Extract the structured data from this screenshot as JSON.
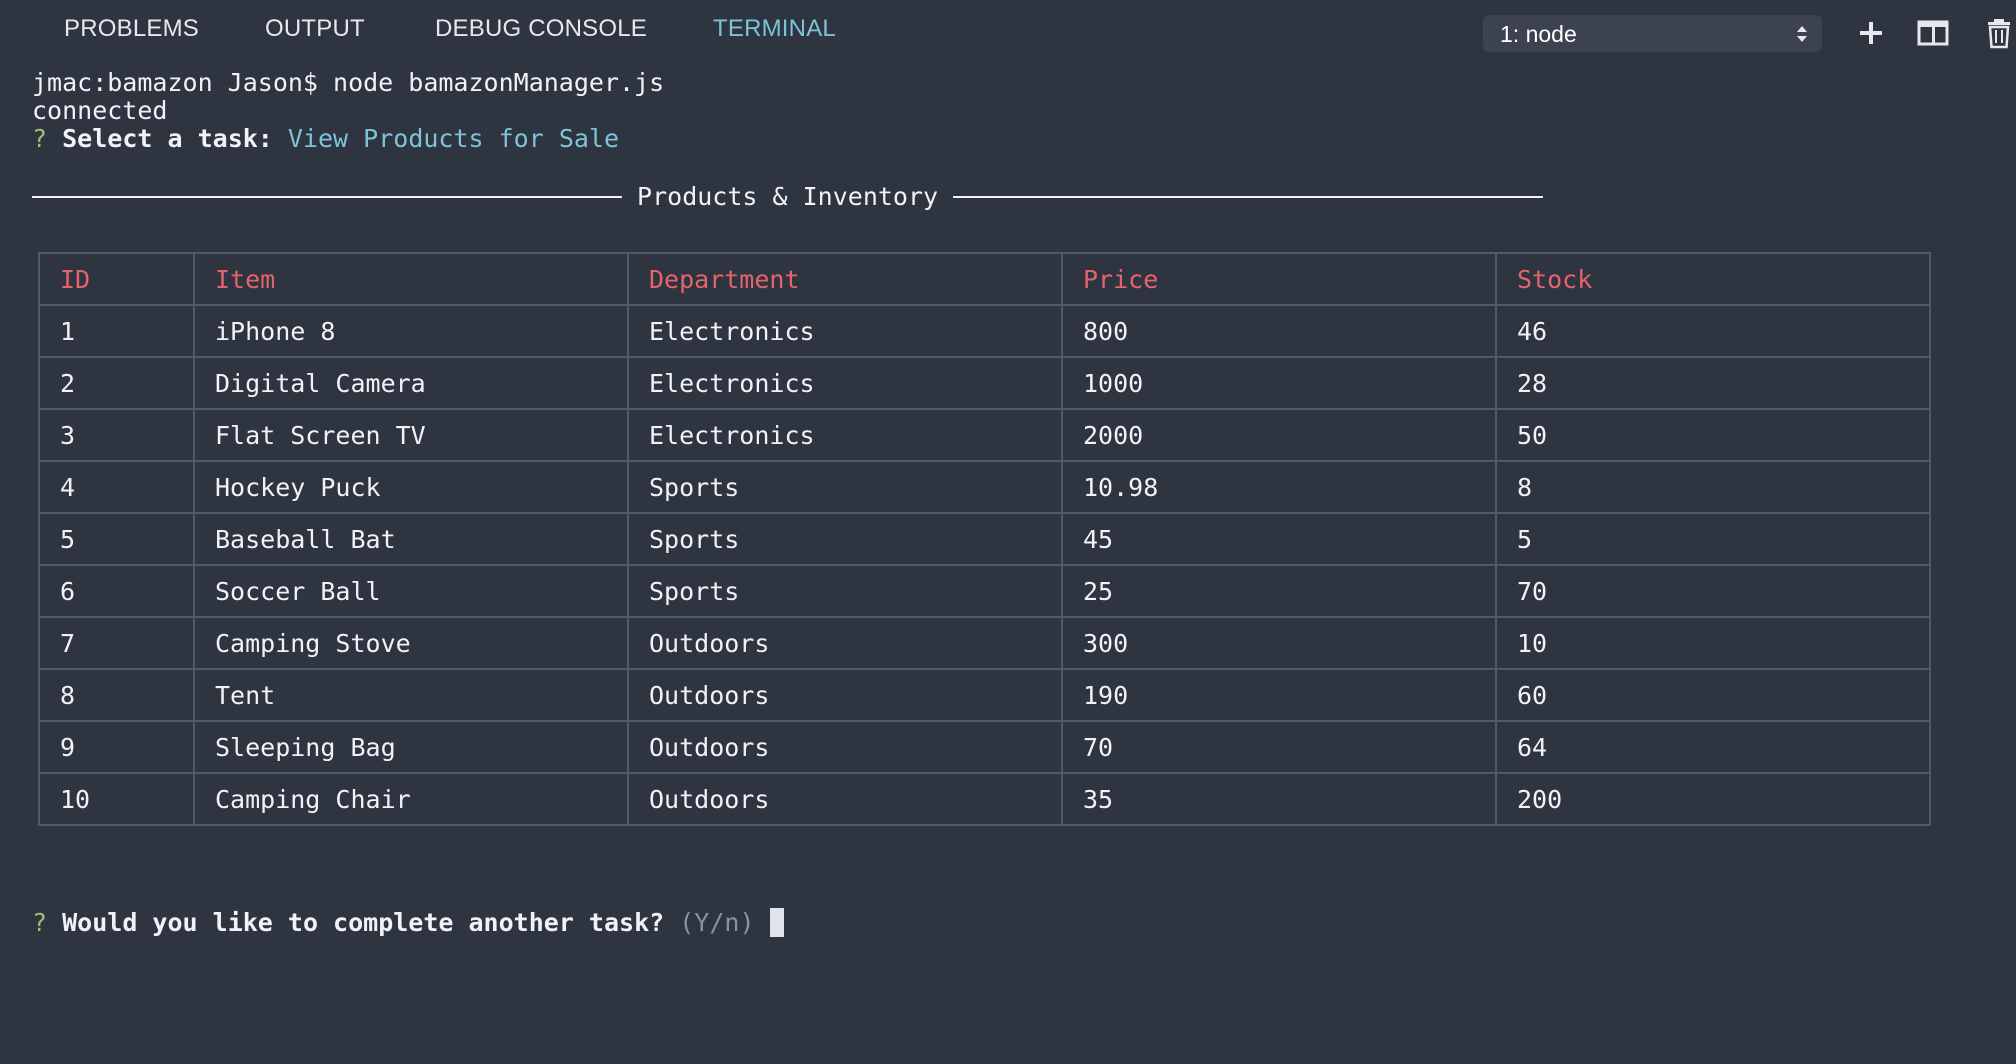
{
  "tabs": {
    "problems": "PROBLEMS",
    "output": "OUTPUT",
    "debug_console": "DEBUG CONSOLE",
    "terminal": "TERMINAL"
  },
  "terminal_select": {
    "value": "1: node"
  },
  "icons": {
    "new_terminal": "plus-icon",
    "split_terminal": "split-panel-icon",
    "kill_terminal": "trash-icon"
  },
  "colors": {
    "background": "#2f3441",
    "active_tab": "#7ec3d8",
    "prompt_mark": "#9cbf72",
    "table_header": "#e5636a",
    "table_border": "#51586a"
  },
  "terminal": {
    "command_line": "jmac:bamazon Jason$ node bamazonManager.js",
    "connected": "connected",
    "question_mark": "?",
    "task_prompt": "Select a task:",
    "task_answer": "View Products for Sale",
    "table_title": " Products & Inventory ",
    "another_prompt": "Would you like to complete another task?",
    "another_hint": "(Y/n)"
  },
  "table": {
    "headers": [
      "ID",
      "Item",
      "Department",
      "Price",
      "Stock"
    ],
    "rows": [
      [
        "1",
        "iPhone 8",
        "Electronics",
        "800",
        "46"
      ],
      [
        "2",
        "Digital Camera",
        "Electronics",
        "1000",
        "28"
      ],
      [
        "3",
        "Flat Screen TV",
        "Electronics",
        "2000",
        "50"
      ],
      [
        "4",
        "Hockey Puck",
        "Sports",
        "10.98",
        "8"
      ],
      [
        "5",
        "Baseball Bat",
        "Sports",
        "45",
        "5"
      ],
      [
        "6",
        "Soccer Ball",
        "Sports",
        "25",
        "70"
      ],
      [
        "7",
        "Camping Stove",
        "Outdoors",
        "300",
        "10"
      ],
      [
        "8",
        "Tent",
        "Outdoors",
        "190",
        "60"
      ],
      [
        "9",
        "Sleeping Bag",
        "Outdoors",
        "70",
        "64"
      ],
      [
        "10",
        "Camping Chair",
        "Outdoors",
        "35",
        "200"
      ]
    ]
  }
}
